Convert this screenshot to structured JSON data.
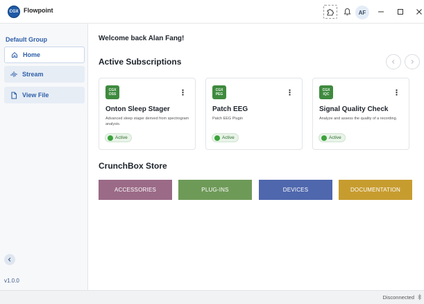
{
  "app": {
    "title": "Flowpoint",
    "logo_text": "CGX"
  },
  "titlebar": {
    "avatar_initials": "AF",
    "icons": [
      "puzzle-icon",
      "bell-icon"
    ],
    "window_controls": [
      "minimize",
      "maximize",
      "close"
    ]
  },
  "sidebar": {
    "group_label": "Default Group",
    "items": [
      {
        "label": "Home",
        "icon": "home-icon",
        "active": true
      },
      {
        "label": "Stream",
        "icon": "stream-icon",
        "active": false
      },
      {
        "label": "View File",
        "icon": "file-icon",
        "active": false
      }
    ],
    "version": "v1.0.0"
  },
  "main": {
    "welcome": "Welcome back Alan Fang!",
    "subscriptions_title": "Active Subscriptions",
    "store_title": "CrunchBox Store",
    "cards": [
      {
        "logo_line1": "CGX",
        "logo_line2": "OSS",
        "title": "Onton Sleep Stager",
        "description": "Advanced sleep stager derived from spectrogram analysis.",
        "status": "Active"
      },
      {
        "logo_line1": "CGX",
        "logo_line2": "PEG",
        "title": "Patch EEG",
        "description": "Patch EEG Plugin",
        "status": "Active"
      },
      {
        "logo_line1": "CGX",
        "logo_line2": "IQC",
        "title": "Signal Quality Check",
        "description": "Analyze and assess the quality of a recording.",
        "status": "Active"
      }
    ],
    "store_buttons": [
      {
        "label": "ACCESSORIES",
        "color": "#9b6a87"
      },
      {
        "label": "PLUG-INS",
        "color": "#6e9a58"
      },
      {
        "label": "DEVICES",
        "color": "#4f67ad"
      },
      {
        "label": "DOCUMENTATION",
        "color": "#c79c2f"
      }
    ]
  },
  "statusbar": {
    "connection": "Disconnected"
  },
  "colors": {
    "accent": "#2e5fa8",
    "active_green": "#3ba33b"
  }
}
